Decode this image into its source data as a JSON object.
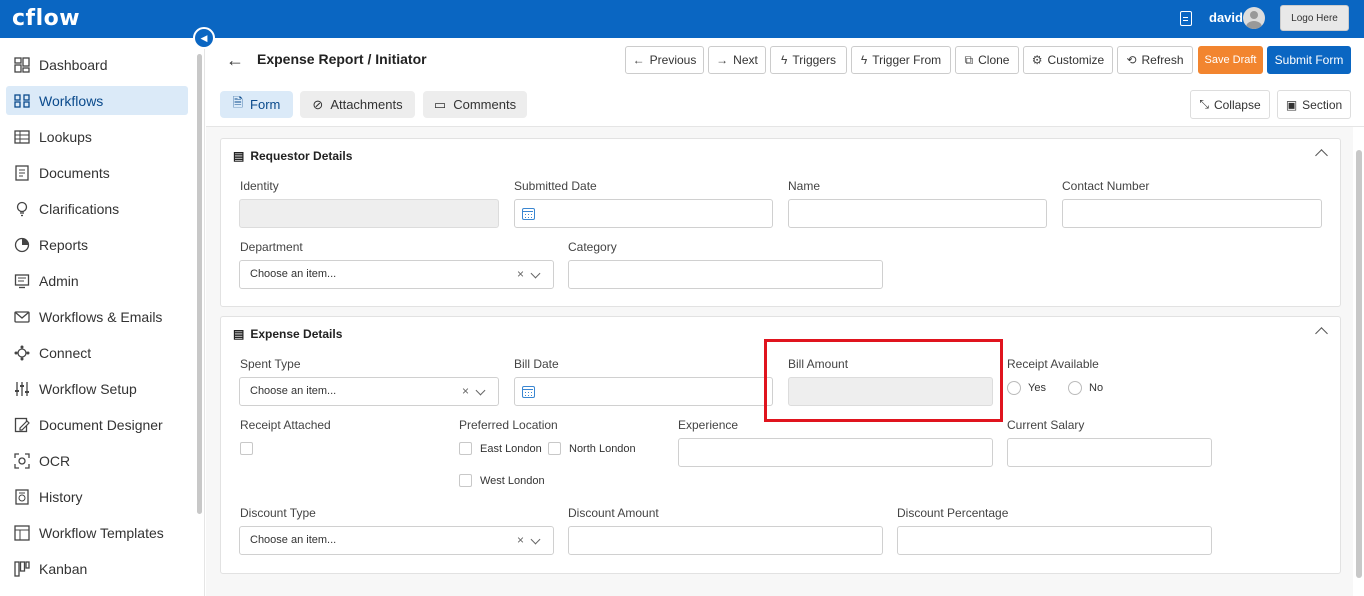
{
  "app": {
    "logo": "cflow",
    "user_name": "david",
    "logo_placeholder": "Logo Here"
  },
  "sidebar": {
    "items": [
      {
        "label": "Dashboard",
        "icon": "dashboard-icon"
      },
      {
        "label": "Workflows",
        "icon": "workflows-icon",
        "active": true
      },
      {
        "label": "Lookups",
        "icon": "table-icon"
      },
      {
        "label": "Documents",
        "icon": "document-icon"
      },
      {
        "label": "Clarifications",
        "icon": "lightbulb-icon"
      },
      {
        "label": "Reports",
        "icon": "pie-chart-icon"
      },
      {
        "label": "Admin",
        "icon": "admin-icon"
      },
      {
        "label": "Workflows & Emails",
        "icon": "mail-icon"
      },
      {
        "label": "Connect",
        "icon": "connect-icon"
      },
      {
        "label": "Workflow Setup",
        "icon": "sliders-icon"
      },
      {
        "label": "Document Designer",
        "icon": "edit-doc-icon"
      },
      {
        "label": "OCR",
        "icon": "scan-icon"
      },
      {
        "label": "History",
        "icon": "history-icon"
      },
      {
        "label": "Workflow Templates",
        "icon": "template-icon"
      },
      {
        "label": "Kanban",
        "icon": "kanban-icon"
      }
    ]
  },
  "header": {
    "title": "Expense Report / Initiator",
    "buttons": {
      "previous": "Previous",
      "next": "Next",
      "triggers": "Triggers",
      "trigger_from": "Trigger From",
      "clone": "Clone",
      "customize": "Customize",
      "refresh": "Refresh",
      "save_draft": "Save Draft",
      "submit_form": "Submit Form"
    }
  },
  "tabs": {
    "form": "Form",
    "attachments": "Attachments",
    "comments": "Comments"
  },
  "view_controls": {
    "collapse": "Collapse",
    "section": "Section"
  },
  "requestor_section": {
    "title": "Requestor Details",
    "identity_label": "Identity",
    "submitted_date_label": "Submitted Date",
    "name_label": "Name",
    "contact_number_label": "Contact Number",
    "department_label": "Department",
    "department_placeholder": "Choose an item...",
    "category_label": "Category"
  },
  "expense_section": {
    "title": "Expense Details",
    "spent_type_label": "Spent Type",
    "spent_type_placeholder": "Choose an item...",
    "bill_date_label": "Bill Date",
    "bill_amount_label": "Bill Amount",
    "receipt_available_label": "Receipt Available",
    "receipt_yes": "Yes",
    "receipt_no": "No",
    "receipt_attached_label": "Receipt Attached",
    "preferred_location_label": "Preferred Location",
    "location_east": "East London",
    "location_north": "North London",
    "location_west": "West London",
    "experience_label": "Experience",
    "current_salary_label": "Current Salary",
    "discount_type_label": "Discount Type",
    "discount_type_placeholder": "Choose an item...",
    "discount_amount_label": "Discount Amount",
    "discount_percentage_label": "Discount Percentage"
  },
  "colors": {
    "brand": "#0a66c2",
    "save_draft": "#f2852f",
    "highlight": "#e0141e"
  }
}
